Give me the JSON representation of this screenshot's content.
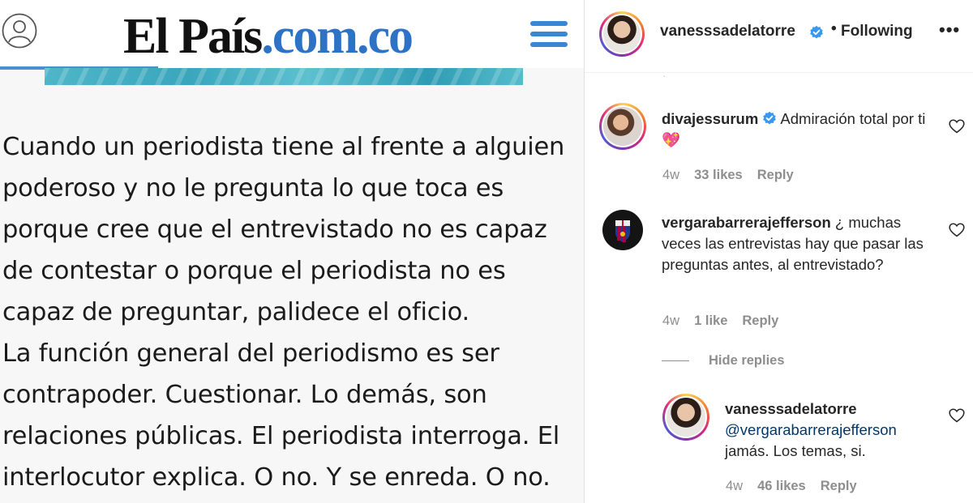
{
  "left": {
    "logo_main": "El País",
    "logo_domain": ".com.co",
    "article_lines": [
      "Cuando un periodista tiene al frente a alguien",
      "poderoso y no le pregunta lo que toca es",
      "porque cree que el entrevistado no es capaz",
      "de contestar o porque el periodista no es",
      "capaz de preguntar, palidece el oficio.",
      "La función general del periodismo es ser",
      "contrapoder. Cuestionar. Lo demás, son",
      "relaciones públicas. El periodista interroga. El",
      "interlocutor explica. O no. Y se enreda. O no."
    ]
  },
  "header": {
    "username": "vanesssadelatorre",
    "dot": "•",
    "following": "Following",
    "more": "•••",
    "partial": "·"
  },
  "comments": [
    {
      "username": "divajessurum",
      "text": "Admiración total por ti",
      "emoji": "💖",
      "time": "4w",
      "likes": "33 likes",
      "reply": "Reply"
    },
    {
      "username": "vergarabarrerajefferson",
      "text": "¿ muchas veces las entrevistas hay que pasar las preguntas antes, al entrevistado?",
      "time": "4w",
      "likes": "1 like",
      "reply": "Reply"
    }
  ],
  "hide_replies": "Hide replies",
  "reply_comment": {
    "username": "vanesssadelatorre",
    "mention": "@vergarabarrerajefferson",
    "text": "jamás. Los temas, si.",
    "time": "4w",
    "likes": "46 likes",
    "reply": "Reply"
  },
  "colors": {
    "logo_blue": "#2d72c4",
    "menu_blue": "#3a86d2",
    "verified_blue": "#3897f0",
    "meta_gray": "#8e8e8e",
    "mention_blue": "#00376b"
  },
  "icons": [
    "user-profile-icon",
    "hamburger-menu-icon",
    "verified-badge-icon",
    "more-options-icon",
    "heart-icon"
  ]
}
